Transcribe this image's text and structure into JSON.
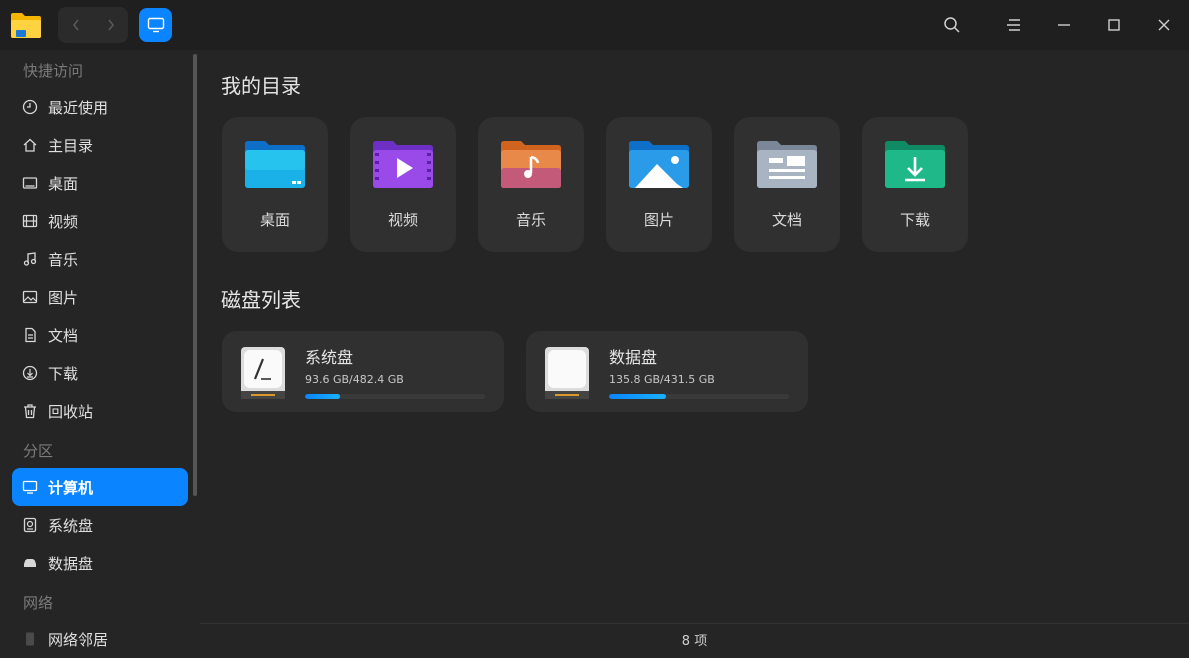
{
  "titlebar": {
    "back_icon": "chevron-left-icon",
    "forward_icon": "chevron-right-icon",
    "view_icon": "monitor-icon"
  },
  "sidebar": {
    "quick_access_title": "快捷访问",
    "quick_items": [
      {
        "label": "最近使用",
        "icon": "clock-icon"
      },
      {
        "label": "主目录",
        "icon": "home-icon"
      },
      {
        "label": "桌面",
        "icon": "desktop-icon"
      },
      {
        "label": "视频",
        "icon": "film-icon"
      },
      {
        "label": "音乐",
        "icon": "music-icon"
      },
      {
        "label": "图片",
        "icon": "image-icon"
      },
      {
        "label": "文档",
        "icon": "document-icon"
      },
      {
        "label": "下载",
        "icon": "download-icon"
      },
      {
        "label": "回收站",
        "icon": "trash-icon"
      }
    ],
    "partition_title": "分区",
    "partition_items": [
      {
        "label": "计算机",
        "icon": "computer-icon",
        "active": true
      },
      {
        "label": "系统盘",
        "icon": "disk-icon"
      },
      {
        "label": "数据盘",
        "icon": "drive-icon"
      }
    ],
    "network_title": "网络",
    "network_items": [
      {
        "label": "网络邻居",
        "icon": "network-icon"
      }
    ]
  },
  "main": {
    "dirs_title": "我的目录",
    "dirs": [
      {
        "label": "桌面",
        "icon": "desktop-folder-icon"
      },
      {
        "label": "视频",
        "icon": "video-folder-icon"
      },
      {
        "label": "音乐",
        "icon": "music-folder-icon"
      },
      {
        "label": "图片",
        "icon": "pictures-folder-icon"
      },
      {
        "label": "文档",
        "icon": "documents-folder-icon"
      },
      {
        "label": "下载",
        "icon": "downloads-folder-icon"
      }
    ],
    "disks_title": "磁盘列表",
    "disks": [
      {
        "name": "系统盘",
        "size": "93.6 GB/482.4 GB",
        "used_fraction": 0.194
      },
      {
        "name": "数据盘",
        "size": "135.8 GB/431.5 GB",
        "used_fraction": 0.315
      }
    ]
  },
  "status": {
    "count": "8 项"
  },
  "colors": {
    "accent": "#0a84ff",
    "background": "#252525",
    "tile": "#303030"
  }
}
